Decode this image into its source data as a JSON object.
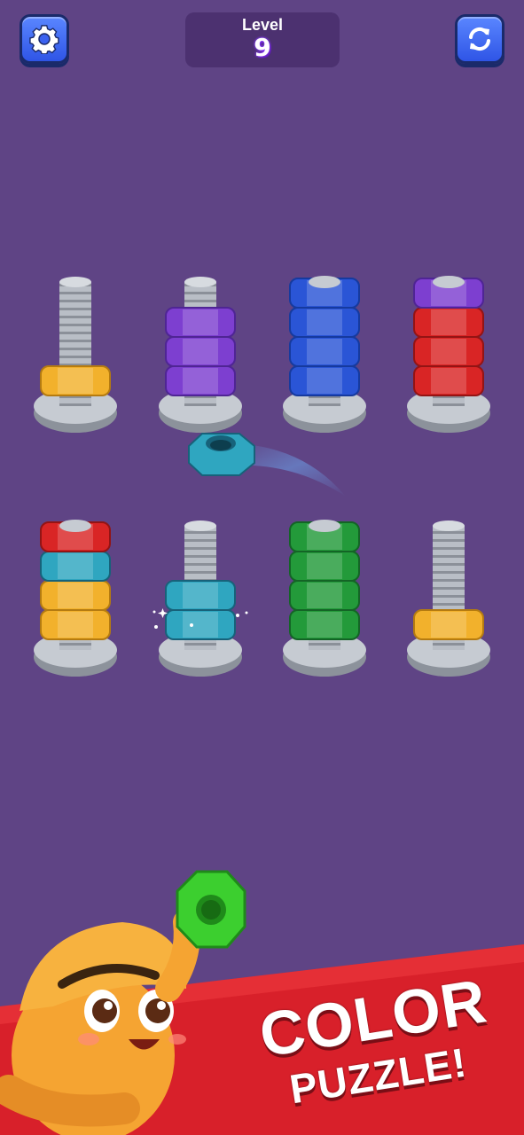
{
  "header": {
    "level_label": "Level",
    "level_number": "9",
    "settings_icon": "gear-icon",
    "restart_icon": "restart-icon"
  },
  "board": {
    "row1": [
      {
        "name": "bolt-1",
        "nuts": [
          "yellow"
        ]
      },
      {
        "name": "bolt-2",
        "nuts": [
          "purple",
          "purple",
          "purple"
        ]
      },
      {
        "name": "bolt-3",
        "nuts": [
          "blue",
          "blue",
          "blue",
          "blue"
        ]
      },
      {
        "name": "bolt-4",
        "nuts": [
          "red",
          "red",
          "red",
          "purple"
        ]
      }
    ],
    "row2": [
      {
        "name": "bolt-5",
        "nuts": [
          "yellow",
          "yellow",
          "teal",
          "red"
        ]
      },
      {
        "name": "bolt-6",
        "nuts": [
          "teal",
          "teal"
        ]
      },
      {
        "name": "bolt-7",
        "nuts": [
          "green",
          "green",
          "green",
          "green"
        ]
      },
      {
        "name": "bolt-8",
        "nuts": [
          "yellow"
        ]
      }
    ],
    "moving_nut": "teal"
  },
  "colors": {
    "yellow": "#f2b12c",
    "purple": "#7d3fd0",
    "blue": "#2a55d6",
    "red": "#d92525",
    "teal": "#2fa6c0",
    "green": "#239a3a",
    "background": "#5f4485",
    "banner": "#d8202a"
  },
  "banner": {
    "line1": "COLOR",
    "line2": "PUZZLE!"
  }
}
